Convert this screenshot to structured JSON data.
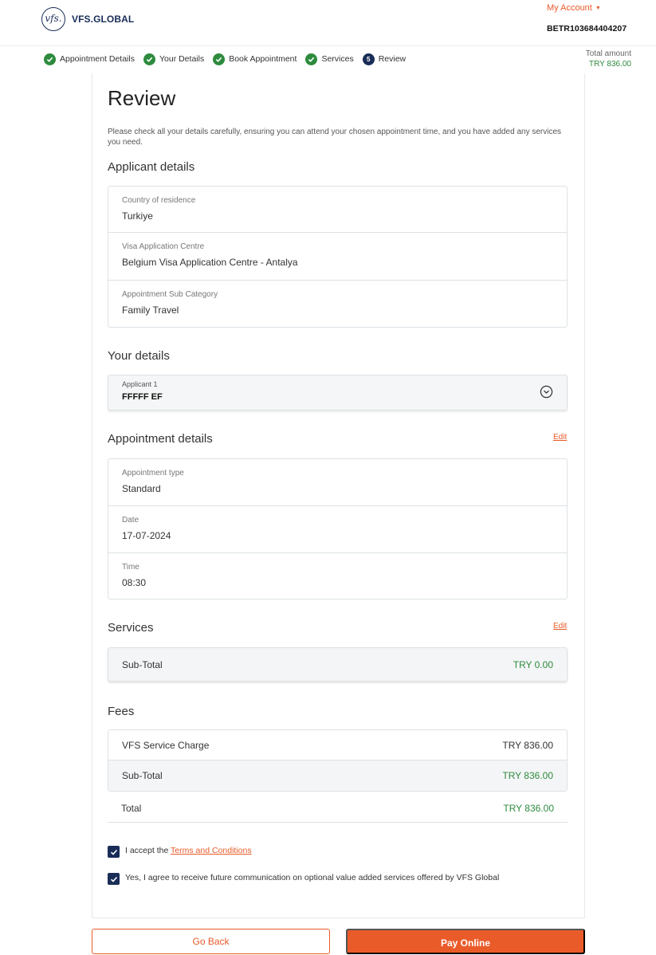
{
  "header": {
    "logo_mark": "vfs.",
    "logo_text": "VFS.GLOBAL",
    "account_label": "My Account",
    "reference": "BETR103684404207"
  },
  "stepper": {
    "steps": [
      {
        "label": "Appointment Details",
        "done": true
      },
      {
        "label": "Your Details",
        "done": true
      },
      {
        "label": "Book Appointment",
        "done": true
      },
      {
        "label": "Services",
        "done": true
      },
      {
        "label": "Review",
        "number": "5",
        "done": false
      }
    ],
    "total_label": "Total amount",
    "total_value": "TRY 836.00"
  },
  "page": {
    "title": "Review",
    "intro": "Please check all your details carefully, ensuring you can attend your chosen appointment time, and you have added any services you need."
  },
  "applicant_details": {
    "heading": "Applicant details",
    "fields": [
      {
        "label": "Country of residence",
        "value": "Turkiye"
      },
      {
        "label": "Visa Application Centre",
        "value": "Belgium Visa Application Centre - Antalya"
      },
      {
        "label": "Appointment Sub Category",
        "value": "Family Travel"
      }
    ]
  },
  "your_details": {
    "heading": "Your details",
    "applicant_label": "Applicant 1",
    "applicant_name": "FFFFF EF"
  },
  "appointment_details": {
    "heading": "Appointment details",
    "edit_label": "Edit",
    "fields": [
      {
        "label": "Appointment type",
        "value": "Standard"
      },
      {
        "label": "Date",
        "value": "17-07-2024"
      },
      {
        "label": "Time",
        "value": "08:30"
      }
    ]
  },
  "services": {
    "heading": "Services",
    "edit_label": "Edit",
    "subtotal_label": "Sub-Total",
    "subtotal_value": "TRY 0.00"
  },
  "fees": {
    "heading": "Fees",
    "service_charge_label": "VFS Service Charge",
    "service_charge_value": "TRY 836.00",
    "subtotal_label": "Sub-Total",
    "subtotal_value": "TRY 836.00",
    "total_label": "Total",
    "total_value": "TRY 836.00"
  },
  "consent": {
    "terms_prefix": "I accept the",
    "terms_link": "Terms and Conditions",
    "marketing": "Yes, I agree to receive future communication on optional value added services offered by VFS Global",
    "terms_checked": true,
    "marketing_checked": true
  },
  "actions": {
    "back_label": "Go Back",
    "pay_label": "Pay Online"
  },
  "colors": {
    "accent": "#ea5b2a",
    "success": "#2e8b3e",
    "navy": "#1a2d57"
  }
}
